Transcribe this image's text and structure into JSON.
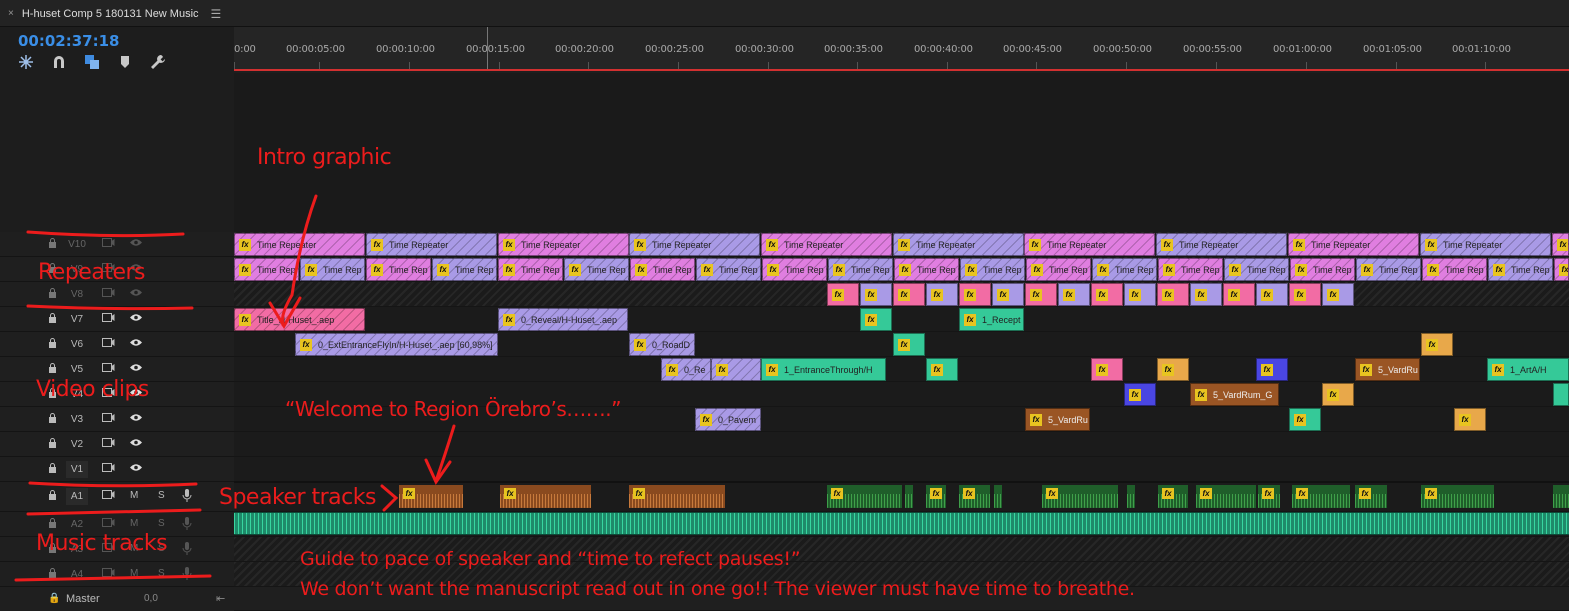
{
  "sequence": {
    "tab_title": "H-huset Comp 5 180131 New Music",
    "close_symbol": "×",
    "menu_symbol": "☰",
    "timecode": "00:02:37:18"
  },
  "toolbar_icons": [
    "ripple-icon",
    "snap-magnet-icon",
    "linked-selection-icon",
    "marker-icon",
    "wrench-settings-icon"
  ],
  "ruler": {
    "ticks": [
      "0:00",
      "00:00:05:00",
      "00:00:10:00",
      "00:00:15:00",
      "00:00:20:00",
      "00:00:25:00",
      "00:00:30:00",
      "00:00:35:00",
      "00:00:40:00",
      "00:00:45:00",
      "00:00:50:00",
      "00:00:55:00",
      "00:01:00:00",
      "00:01:05:00",
      "00:01:10:00"
    ]
  },
  "tracks": {
    "video": [
      "V10",
      "V9",
      "V8",
      "V7",
      "V6",
      "V5",
      "V4",
      "V3",
      "V2",
      "V1"
    ],
    "audio": [
      "A1",
      "A2",
      "A3",
      "A4"
    ],
    "m_label": "M",
    "s_label": "S",
    "master_label": "Master",
    "master_value": "0,0"
  },
  "clips": {
    "fx_label": "fx",
    "v10": "Time Repeater",
    "v9": [
      "Time Rep",
      "Time Rep"
    ],
    "v7": [
      "Title_H-Huset_.aep",
      "0_Reveal/H-Huset_.aep",
      "1_Recept"
    ],
    "v6": [
      "0_ExtEntranceFlyIn/H-Huset_.aep [60,98%]",
      "0_RoadD"
    ],
    "v5": [
      "0_Re",
      "1_EntranceThrough/H",
      "5_VardRu",
      "1_ArtA/H"
    ],
    "v4": [
      "5_VardRum_G"
    ],
    "v3": [
      "0_Pavem",
      "5_VardRu"
    ]
  },
  "annotations": {
    "intro_graphic": "Intro graphic",
    "repeaters": "Repeaters",
    "video_clips": "Video clips",
    "welcome": "“Welcome to Region Örebro’s…….”",
    "speaker_tracks": "Speaker tracks",
    "music_tracks": "Music tracks",
    "guide_line1": "Guide to pace of speaker and “time to refect pauses!”",
    "guide_line2": "We don’t want the manuscript read out in one go!! The viewer must have time to breathe.",
    "color": "#ec1c1c"
  },
  "colors": {
    "timecode": "#3a8ee6",
    "playhead_line": "#d23030",
    "clip_pink": "#e07ee0",
    "clip_lavender": "#a99ae6",
    "clip_teal": "#35c998",
    "clip_orange": "#e8a84a",
    "clip_blue": "#4a46e2",
    "clip_brown": "#9a5524",
    "music": "#1f8a6a"
  }
}
